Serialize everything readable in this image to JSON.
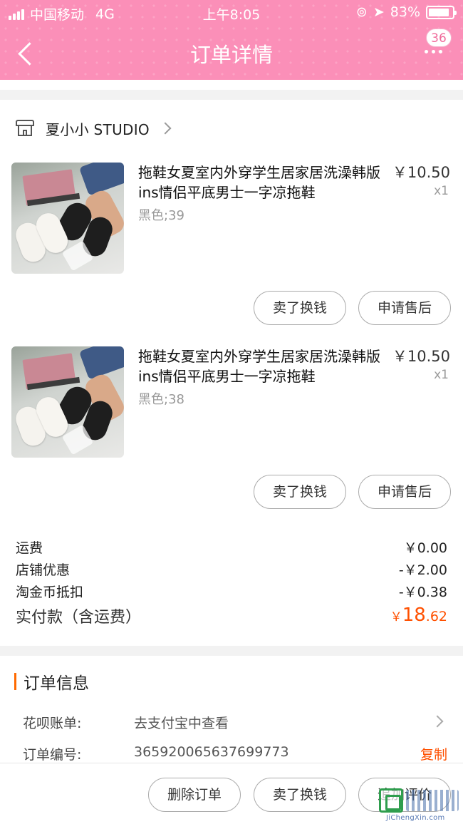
{
  "status_bar": {
    "carrier": "中国移动",
    "network": "4G",
    "time": "上午8:05",
    "battery": "83%"
  },
  "nav": {
    "title": "订单详情",
    "badge_count": "36"
  },
  "shop": {
    "name": "夏小小 STUDIO"
  },
  "items": [
    {
      "title": "拖鞋女夏室内外穿学生居家居洗澡韩版ins情侣平底男士一字凉拖鞋",
      "sku": "黑色;39",
      "price": "￥10.50",
      "qty": "x1",
      "buttons": [
        "卖了换钱",
        "申请售后"
      ]
    },
    {
      "title": "拖鞋女夏室内外穿学生居家居洗澡韩版ins情侣平底男士一字凉拖鞋",
      "sku": "黑色;38",
      "price": "￥10.50",
      "qty": "x1",
      "buttons": [
        "卖了换钱",
        "申请售后"
      ]
    }
  ],
  "fees": [
    {
      "label": "运费",
      "value": "￥0.00"
    },
    {
      "label": "店铺优惠",
      "value": "-￥2.00"
    },
    {
      "label": "淘金币抵扣",
      "value": "-￥0.38"
    }
  ],
  "total": {
    "label": "实付款（含运费）",
    "currency": "￥",
    "int": "18",
    "dec": ".62"
  },
  "order_info": {
    "heading": "订单信息",
    "huabei_label": "花呗账单:",
    "huabei_value": "去支付宝中查看",
    "order_no_label": "订单编号:",
    "order_no_value": "365920065637699773",
    "copy_label": "复制"
  },
  "bottom_bar": {
    "buttons": [
      "删除订单",
      "卖了换钱",
      "追加评价"
    ]
  },
  "watermark": {
    "url": "JiChengXin.com"
  }
}
